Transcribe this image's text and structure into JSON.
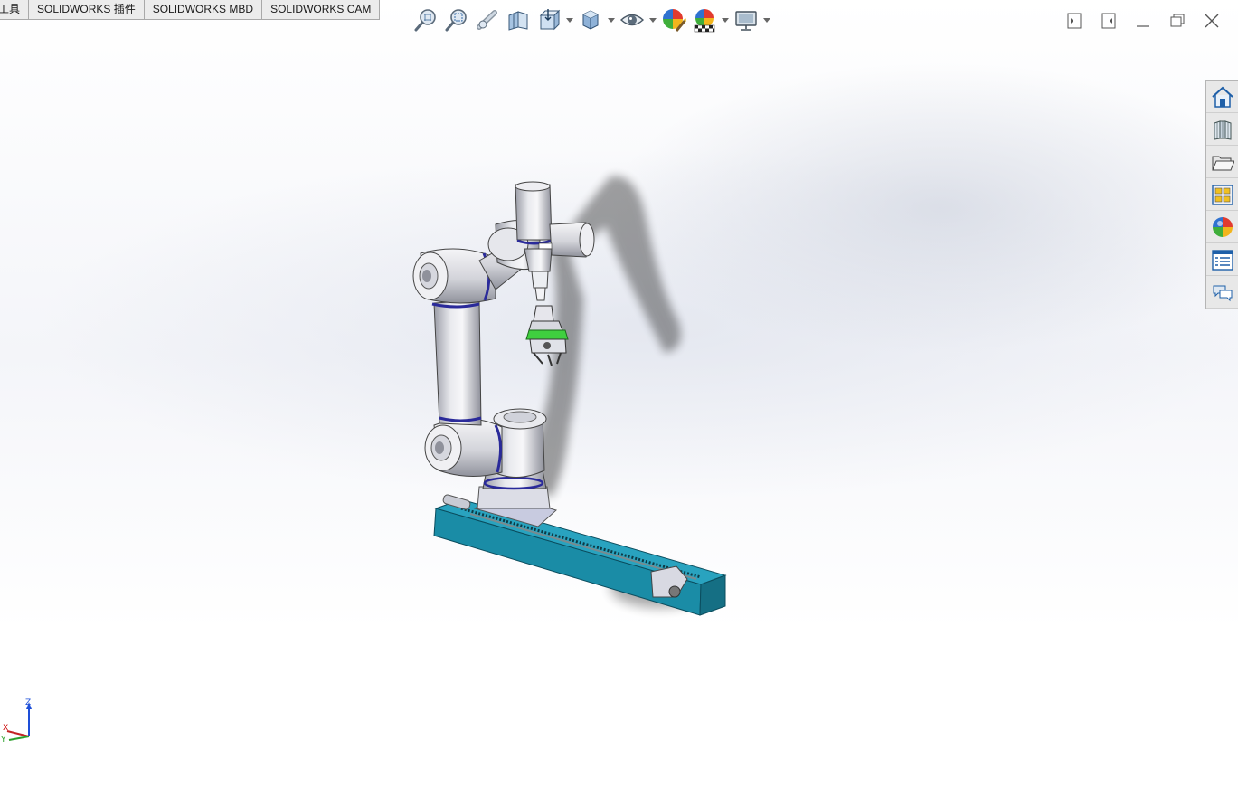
{
  "tabs": [
    {
      "label": "工具"
    },
    {
      "label": "SOLIDWORKS 插件"
    },
    {
      "label": "SOLIDWORKS MBD"
    },
    {
      "label": "SOLIDWORKS CAM"
    }
  ],
  "hud_toolbar": {
    "items": [
      "zoom-to-fit-icon",
      "zoom-to-area-icon",
      "previous-view-icon",
      "section-view-icon",
      "view-orientation-icon",
      "display-style-icon",
      "hide-show-items-icon",
      "edit-appearance-icon",
      "apply-scene-icon",
      "view-settings-icon"
    ]
  },
  "task_pane": {
    "items": [
      "home-icon",
      "design-library-icon",
      "file-explorer-icon",
      "view-palette-icon",
      "appearances-icon",
      "custom-properties-icon",
      "forum-icon"
    ]
  },
  "triad": {
    "x": "X",
    "y": "Y",
    "z": "Z"
  },
  "colors": {
    "rail_blue": "#1a8ca6",
    "joint_ring": "#2a2a9a",
    "gripper_green": "#3fcf3f"
  }
}
